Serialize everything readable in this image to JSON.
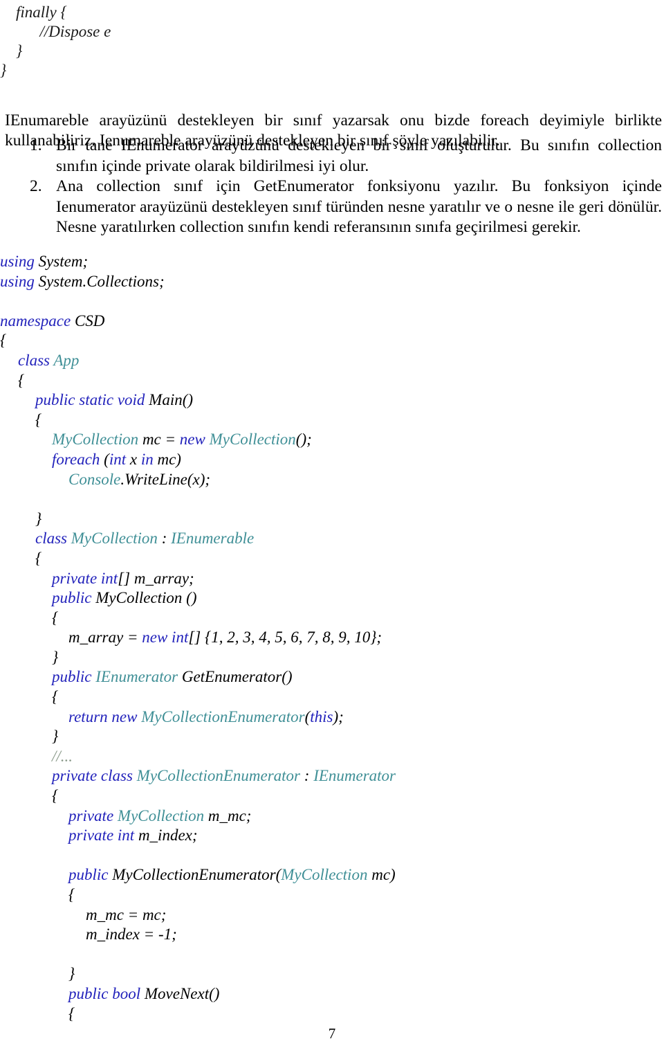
{
  "document": {
    "page_number": "7",
    "language": "tr",
    "colors": {
      "keyword": "#2222bb",
      "type": "#3f8f96",
      "comment": "#8a9a8a",
      "plain": "#000000",
      "background": "#ffffff"
    }
  },
  "top_code_fragment": [
    "    finally {",
    "          //Dispose e",
    "    }",
    "}"
  ],
  "prose": {
    "intro": "IEnumareble arayüzünü destekleyen bir sınıf yazarsak onu bizde foreach deyimiyle birlikte kullanabiliriz. Ienumareble arayüzünü destekleyen bir sınıf şöyle yazılabilir.",
    "list": [
      {
        "marker": "1.",
        "text": "Bir tane IEnumerator arayüzünü destekleyen bir sınıf oluşturulur. Bu sınıfın collection sınıfın içinde private olarak bildirilmesi iyi olur."
      },
      {
        "marker": "2.",
        "text": "Ana collection sınıf için GetEnumerator fonksiyonu yazılır. Bu fonksiyon içinde Ienumerator arayüzünü  destekleyen sınıf türünden nesne yaratılır ve o nesne ile geri dönülür. Nesne yaratılırken collection sınıfın kendi referansının sınıfa geçirilmesi gerekir."
      }
    ]
  },
  "code_block": {
    "lines": [
      {
        "indent": 0,
        "spans": [
          {
            "t": "using ",
            "c": "kw"
          },
          {
            "t": "System;",
            "c": "pl"
          }
        ]
      },
      {
        "indent": 0,
        "spans": [
          {
            "t": "using ",
            "c": "kw"
          },
          {
            "t": "System.Collections;",
            "c": "pl"
          }
        ]
      },
      {
        "indent": 0,
        "spans": [
          {
            "t": "",
            "c": "pl"
          }
        ]
      },
      {
        "indent": 0,
        "spans": [
          {
            "t": "namespace ",
            "c": "kw"
          },
          {
            "t": "CSD",
            "c": "pl"
          }
        ]
      },
      {
        "indent": 0,
        "spans": [
          {
            "t": "{",
            "c": "pl"
          }
        ]
      },
      {
        "indent": 26,
        "spans": [
          {
            "t": "class ",
            "c": "kw"
          },
          {
            "t": "App",
            "c": "type"
          }
        ]
      },
      {
        "indent": 26,
        "spans": [
          {
            "t": "{",
            "c": "pl"
          }
        ]
      },
      {
        "indent": 51,
        "spans": [
          {
            "t": "public static void ",
            "c": "kw"
          },
          {
            "t": "Main()",
            "c": "pl"
          }
        ]
      },
      {
        "indent": 51,
        "spans": [
          {
            "t": "{",
            "c": "pl"
          }
        ]
      },
      {
        "indent": 75,
        "spans": [
          {
            "t": "MyCollection ",
            "c": "type"
          },
          {
            "t": "mc = ",
            "c": "pl"
          },
          {
            "t": "new ",
            "c": "kw"
          },
          {
            "t": "MyCollection",
            "c": "type"
          },
          {
            "t": "();",
            "c": "pl"
          }
        ]
      },
      {
        "indent": 75,
        "spans": [
          {
            "t": "foreach ",
            "c": "kw"
          },
          {
            "t": "(",
            "c": "pl"
          },
          {
            "t": "int ",
            "c": "kw"
          },
          {
            "t": "x ",
            "c": "pl"
          },
          {
            "t": "in ",
            "c": "kw"
          },
          {
            "t": "mc)",
            "c": "pl"
          }
        ]
      },
      {
        "indent": 99,
        "spans": [
          {
            "t": "Console",
            "c": "type"
          },
          {
            "t": ".WriteLine(x);",
            "c": "pl"
          }
        ]
      },
      {
        "indent": 0,
        "spans": [
          {
            "t": "",
            "c": "pl"
          }
        ]
      },
      {
        "indent": 51,
        "spans": [
          {
            "t": "}",
            "c": "pl"
          }
        ]
      },
      {
        "indent": 51,
        "spans": [
          {
            "t": "class ",
            "c": "kw"
          },
          {
            "t": "MyCollection",
            "c": "type"
          },
          {
            "t": " : ",
            "c": "pl"
          },
          {
            "t": "IEnumerable",
            "c": "type"
          }
        ]
      },
      {
        "indent": 51,
        "spans": [
          {
            "t": "{",
            "c": "pl"
          }
        ]
      },
      {
        "indent": 75,
        "spans": [
          {
            "t": "private int",
            "c": "kw"
          },
          {
            "t": "[] m_array;",
            "c": "pl"
          }
        ]
      },
      {
        "indent": 75,
        "spans": [
          {
            "t": "public ",
            "c": "kw"
          },
          {
            "t": "MyCollection ()",
            "c": "pl"
          }
        ]
      },
      {
        "indent": 75,
        "spans": [
          {
            "t": "{",
            "c": "pl"
          }
        ]
      },
      {
        "indent": 99,
        "spans": [
          {
            "t": "m_array = ",
            "c": "pl"
          },
          {
            "t": "new int",
            "c": "kw"
          },
          {
            "t": "[] {1, 2, 3, 4, 5, 6, 7, 8, 9, 10};",
            "c": "pl"
          }
        ]
      },
      {
        "indent": 75,
        "spans": [
          {
            "t": "}",
            "c": "pl"
          }
        ]
      },
      {
        "indent": 75,
        "spans": [
          {
            "t": "public ",
            "c": "kw"
          },
          {
            "t": "IEnumerator ",
            "c": "type"
          },
          {
            "t": "GetEnumerator()",
            "c": "pl"
          }
        ]
      },
      {
        "indent": 75,
        "spans": [
          {
            "t": "{",
            "c": "pl"
          }
        ]
      },
      {
        "indent": 99,
        "spans": [
          {
            "t": "return new ",
            "c": "kw"
          },
          {
            "t": "MyCollectionEnumerator",
            "c": "type"
          },
          {
            "t": "(",
            "c": "pl"
          },
          {
            "t": "this",
            "c": "kw"
          },
          {
            "t": ");",
            "c": "pl"
          }
        ]
      },
      {
        "indent": 75,
        "spans": [
          {
            "t": "}",
            "c": "pl"
          }
        ]
      },
      {
        "indent": 75,
        "spans": [
          {
            "t": "//...",
            "c": "cmt"
          }
        ]
      },
      {
        "indent": 75,
        "spans": [
          {
            "t": "private class ",
            "c": "kw"
          },
          {
            "t": "MyCollectionEnumerator",
            "c": "type"
          },
          {
            "t": " : ",
            "c": "pl"
          },
          {
            "t": "IEnumerator",
            "c": "type"
          }
        ]
      },
      {
        "indent": 75,
        "spans": [
          {
            "t": "{",
            "c": "pl"
          }
        ]
      },
      {
        "indent": 99,
        "spans": [
          {
            "t": "private ",
            "c": "kw"
          },
          {
            "t": "MyCollection ",
            "c": "type"
          },
          {
            "t": "m_mc;",
            "c": "pl"
          }
        ]
      },
      {
        "indent": 99,
        "spans": [
          {
            "t": "private int ",
            "c": "kw"
          },
          {
            "t": "m_index;",
            "c": "pl"
          }
        ]
      },
      {
        "indent": 0,
        "spans": [
          {
            "t": "",
            "c": "pl"
          }
        ]
      },
      {
        "indent": 99,
        "spans": [
          {
            "t": "public ",
            "c": "kw"
          },
          {
            "t": "MyCollectionEnumerator(",
            "c": "pl"
          },
          {
            "t": "MyCollection ",
            "c": "type"
          },
          {
            "t": "mc)",
            "c": "pl"
          }
        ]
      },
      {
        "indent": 99,
        "spans": [
          {
            "t": "{",
            "c": "pl"
          }
        ]
      },
      {
        "indent": 124,
        "spans": [
          {
            "t": "m_mc = mc;",
            "c": "pl"
          }
        ]
      },
      {
        "indent": 124,
        "spans": [
          {
            "t": "m_index = -1;",
            "c": "pl"
          }
        ]
      },
      {
        "indent": 0,
        "spans": [
          {
            "t": "",
            "c": "pl"
          }
        ]
      },
      {
        "indent": 99,
        "spans": [
          {
            "t": "}",
            "c": "pl"
          }
        ]
      },
      {
        "indent": 99,
        "spans": [
          {
            "t": "public bool ",
            "c": "kw"
          },
          {
            "t": "MoveNext()",
            "c": "pl"
          }
        ]
      },
      {
        "indent": 99,
        "spans": [
          {
            "t": "{",
            "c": "pl"
          }
        ]
      }
    ]
  }
}
